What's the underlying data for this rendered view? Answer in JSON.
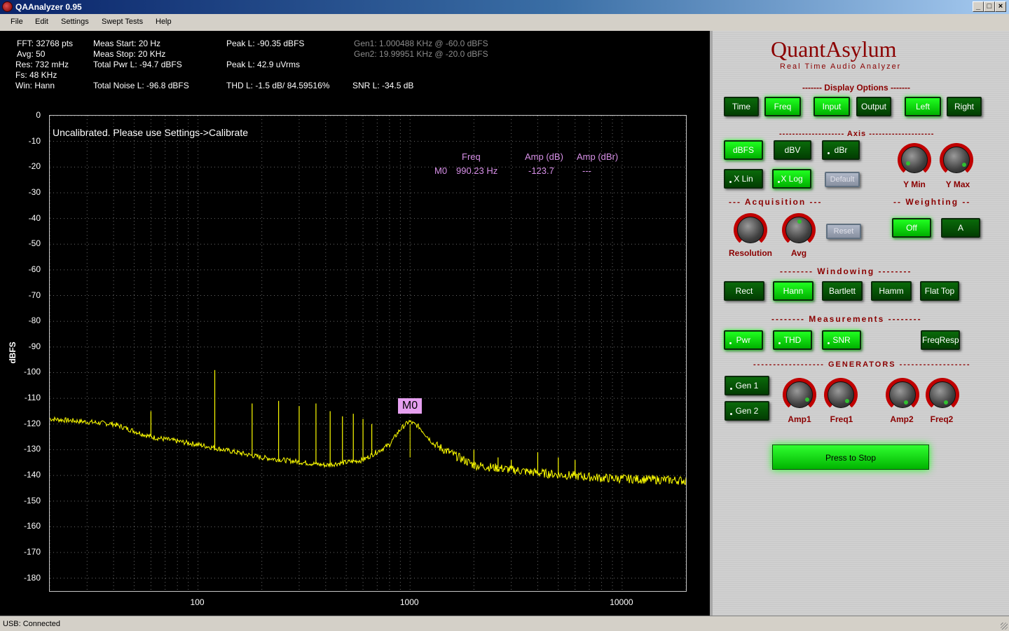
{
  "window": {
    "title": "QAAnalyzer 0.95"
  },
  "menu": [
    "File",
    "Edit",
    "Settings",
    "Swept Tests",
    "Help"
  ],
  "stats": {
    "col1": [
      "FFT: 32768 pts",
      "Avg: 50",
      "Res: 732 mHz",
      "Fs: 48 KHz",
      "Win: Hann"
    ],
    "col2": [
      "Meas Start: 20 Hz",
      "Meas Stop: 20 KHz",
      "Total Pwr L: -94.7 dBFS",
      "Total Noise L: -96.8 dBFS"
    ],
    "col3": [
      "Peak L: -90.35 dBFS",
      "Peak L: 42.9 uVrms",
      "THD L: -1.5 dB/ 84.59516%"
    ],
    "col4": [
      "Gen1: 1.000488 KHz @ -60.0 dBFS",
      "Gen2: 19.99951 KHz @ -20.0 dBFS",
      "SNR L: -34.5 dB"
    ]
  },
  "plot": {
    "notice": "Uncalibrated. Please use Settings->Calibrate",
    "marker_table": {
      "headers": [
        "Freq",
        "Amp (dB)",
        "Amp (dBr)"
      ],
      "row": [
        "M0",
        "990.23 Hz",
        "-123.7",
        "---"
      ]
    },
    "marker_flag": "M0"
  },
  "chart_data": {
    "type": "line",
    "ylabel": "dBFS",
    "xscale": "log",
    "xlim": [
      20,
      20000
    ],
    "ylim": [
      -185,
      0
    ],
    "yticks": [
      "0",
      "-10",
      "-20",
      "-30",
      "-40",
      "-50",
      "-60",
      "-70",
      "-80",
      "-90",
      "-100",
      "-110",
      "-120",
      "-130",
      "-140",
      "-150",
      "-160",
      "-170",
      "-180"
    ],
    "xticks": [
      "100",
      "1000",
      "10000"
    ],
    "grid": true,
    "series": [
      {
        "color": "#ffff00",
        "noise_floor": {
          "x": [
            20,
            40,
            60,
            100,
            200,
            400,
            600,
            800,
            900,
            990,
            1100,
            1300,
            2000,
            4000,
            8000,
            20000
          ],
          "y": [
            -118,
            -120,
            -125,
            -128,
            -133,
            -136,
            -134,
            -128,
            -122,
            -119,
            -121,
            -128,
            -136,
            -139,
            -141,
            -142
          ]
        },
        "spikes": {
          "x": [
            60,
            120,
            180,
            240,
            300,
            360,
            420,
            480,
            540,
            600,
            660,
            1400,
            2000,
            2600,
            3000,
            4000,
            5000,
            6000
          ],
          "y": [
            -115,
            -99,
            -112,
            -111,
            -113,
            -112,
            -115,
            -117,
            -116,
            -118,
            -120,
            -128,
            -130,
            -133,
            -134,
            -131,
            -133,
            -134
          ]
        }
      }
    ]
  },
  "panel": {
    "brand": "QuantAsylum",
    "brand_sub": "Real Time Audio Analyzer",
    "display_options": {
      "label": "------- Display Options -------",
      "buttons": [
        "Time",
        "Freq",
        "Input",
        "Output",
        "Left",
        "Right"
      ]
    },
    "axis": {
      "label": "-------------------- Axis --------------------",
      "buttons": [
        "dBFS",
        "dBV",
        "dBr",
        "X Lin",
        "X Log",
        "Default"
      ],
      "knobs": [
        "Y Min",
        "Y Max"
      ]
    },
    "acquisition": {
      "label": "--- Acquisition ---",
      "knobs": [
        "Resolution",
        "Avg"
      ],
      "reset": "Reset"
    },
    "weighting": {
      "label": "-- Weighting --",
      "buttons": [
        "Off",
        "A"
      ]
    },
    "windowing": {
      "label": "-------- Windowing --------",
      "buttons": [
        "Rect",
        "Hann",
        "Bartlett",
        "Hamm",
        "Flat Top"
      ]
    },
    "measurements": {
      "label": "-------- Measurements --------",
      "buttons": [
        "Pwr",
        "THD",
        "SNR",
        "FreqResp"
      ]
    },
    "generators": {
      "label": "------------------ GENERATORS ------------------",
      "buttons": [
        "Gen 1",
        "Gen 2"
      ],
      "knobs": [
        "Amp1",
        "Freq1",
        "Amp2",
        "Freq2"
      ]
    },
    "stop": "Press to Stop"
  },
  "status": "USB: Connected"
}
